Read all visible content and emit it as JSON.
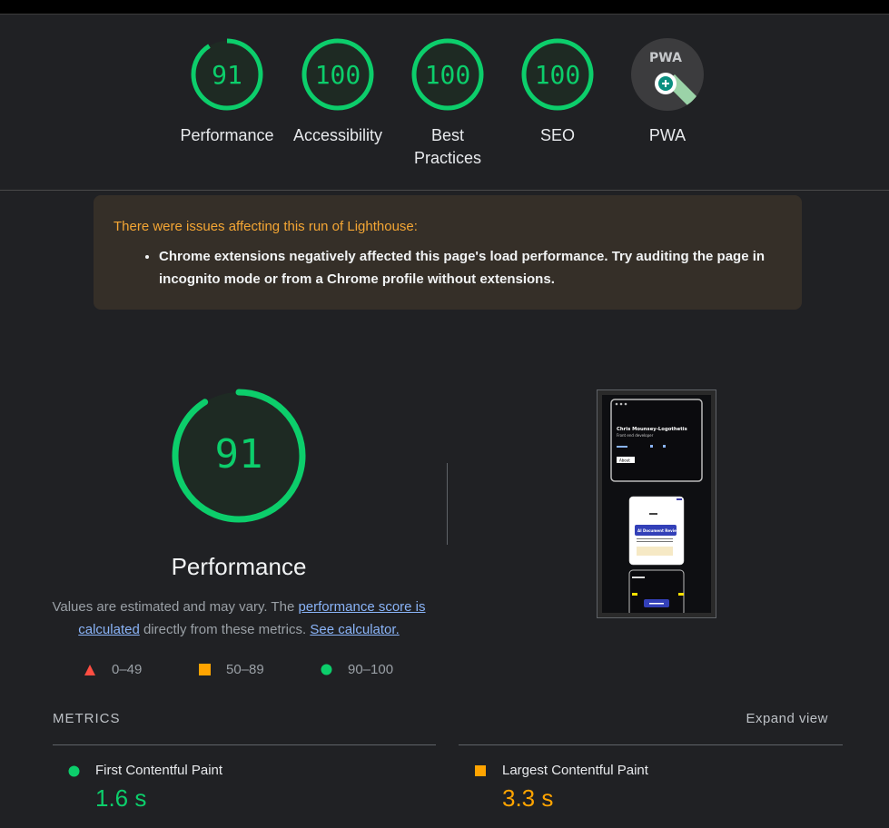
{
  "colors": {
    "pass": "#0cce6b",
    "average": "#ffa400",
    "fail": "#ff4e42",
    "warn_text": "#f4a634",
    "link": "#8ab4f8"
  },
  "gauges": [
    {
      "score": "91",
      "label": "Performance",
      "fraction": 0.91
    },
    {
      "score": "100",
      "label": "Accessibility",
      "fraction": 1.0
    },
    {
      "score": "100",
      "label": "Best Practices",
      "fraction": 1.0
    },
    {
      "score": "100",
      "label": "SEO",
      "fraction": 1.0
    },
    {
      "badge": "PWA",
      "label": "PWA",
      "icon": "pwa-badge-icon"
    }
  ],
  "warning": {
    "title": "There were issues affecting this run of Lighthouse:",
    "items": [
      "Chrome extensions negatively affected this page's load performance. Try auditing the page in incognito mode or from a Chrome profile without extensions."
    ]
  },
  "performance": {
    "score": "91",
    "fraction": 0.91,
    "title": "Performance",
    "desc_pre": "Values are estimated and may vary. The ",
    "desc_link": "performance score is calculated",
    "desc_mid": " directly from these metrics. ",
    "desc_link2": "See calculator."
  },
  "legend": [
    {
      "range": "0–49",
      "icon": "triangle-icon"
    },
    {
      "range": "50–89",
      "icon": "square-icon"
    },
    {
      "range": "90–100",
      "icon": "circle-icon"
    }
  ],
  "screenshot": {
    "name": "Chris Mounsey-Logothetis",
    "role": "Front end developer",
    "button": "About",
    "card": "AI Document Review"
  },
  "metrics": {
    "title": "METRICS",
    "expand": "Expand view",
    "items": [
      {
        "name": "First Contentful Paint",
        "value": "1.6 s",
        "status": "pass"
      },
      {
        "name": "Largest Contentful Paint",
        "value": "3.3 s",
        "status": "average"
      }
    ]
  }
}
